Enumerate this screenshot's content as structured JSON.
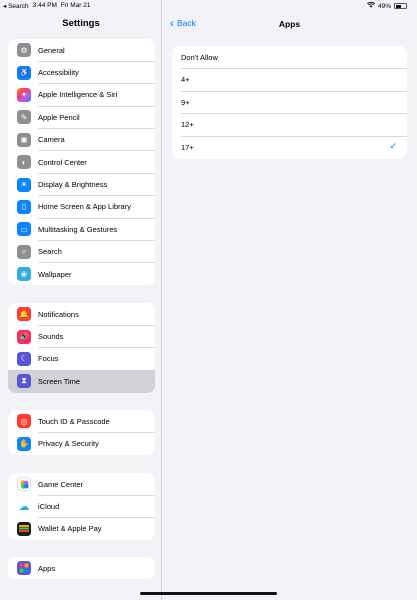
{
  "status": {
    "back_app": "◂ Search",
    "time": "3:44 PM",
    "date": "Fri Mar 21",
    "battery": "49%",
    "battery_level": 0.49
  },
  "sidebar": {
    "title": "Settings",
    "groups": [
      [
        {
          "label": "General",
          "icon": "gear-icon",
          "color": "#8e8e93"
        },
        {
          "label": "Accessibility",
          "icon": "accessibility-icon",
          "color": "#0a84ff"
        },
        {
          "label": "Apple Intelligence & Siri",
          "icon": "siri-icon",
          "color": "#c86dd7"
        },
        {
          "label": "Apple Pencil",
          "icon": "pencil-icon",
          "color": "#8e8e93"
        },
        {
          "label": "Camera",
          "icon": "camera-icon",
          "color": "#8e8e93"
        },
        {
          "label": "Control Center",
          "icon": "control-center-icon",
          "color": "#8e8e93"
        },
        {
          "label": "Display & Brightness",
          "icon": "sun-icon",
          "color": "#0a84ff"
        },
        {
          "label": "Home Screen & App Library",
          "icon": "home-screen-icon",
          "color": "#0a84ff"
        },
        {
          "label": "Multitasking & Gestures",
          "icon": "multitasking-icon",
          "color": "#0a84ff"
        },
        {
          "label": "Search",
          "icon": "search-icon",
          "color": "#8e8e93"
        },
        {
          "label": "Wallpaper",
          "icon": "flower-icon",
          "color": "#32ade6"
        }
      ],
      [
        {
          "label": "Notifications",
          "icon": "bell-icon",
          "color": "#ff3b30"
        },
        {
          "label": "Sounds",
          "icon": "speaker-icon",
          "color": "#ff2d55"
        },
        {
          "label": "Focus",
          "icon": "moon-icon",
          "color": "#5856d6"
        },
        {
          "label": "Screen Time",
          "icon": "hourglass-icon",
          "color": "#5856d6"
        }
      ],
      [
        {
          "label": "Touch ID & Passcode",
          "icon": "fingerprint-icon",
          "color": "#ff3b30"
        },
        {
          "label": "Privacy & Security",
          "icon": "hand-icon",
          "color": "#0a84ff"
        }
      ],
      [
        {
          "label": "Game Center",
          "icon": "game-center-icon",
          "color": "#ffffff"
        },
        {
          "label": "iCloud",
          "icon": "cloud-icon",
          "color": "#ffffff"
        },
        {
          "label": "Wallet & Apple Pay",
          "icon": "wallet-icon",
          "color": "#1c1c1e"
        }
      ],
      [
        {
          "label": "Apps",
          "icon": "apps-grid-icon",
          "color": "#5856d6"
        }
      ]
    ],
    "selected": "Screen Time"
  },
  "main": {
    "back_label": "Back",
    "title": "Apps",
    "options": [
      "Don't Allow",
      "4+",
      "9+",
      "12+",
      "17+"
    ],
    "selected": "17+"
  }
}
